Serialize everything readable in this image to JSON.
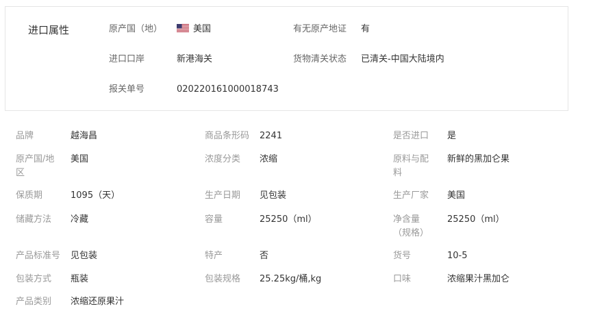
{
  "import_section": {
    "title": "进口属性",
    "origin_country": {
      "label": "原产国（地）",
      "value": "美国",
      "flag": "us-flag"
    },
    "origin_certificate": {
      "label": "有无原产地证",
      "value": "有"
    },
    "port": {
      "label": "进口口岸",
      "value": "新港海关"
    },
    "clearance_status": {
      "label": "货物清关状态",
      "value": "已清关-中国大陆境内"
    },
    "declaration_no": {
      "label": "报关单号",
      "value": "020220161000018743"
    }
  },
  "attributes": {
    "brand": {
      "label": "品牌",
      "value": "越海昌"
    },
    "barcode": {
      "label": "商品条形码",
      "value": "2241"
    },
    "imported": {
      "label": "是否进口",
      "value": "是"
    },
    "origin": {
      "label": "原产国/地区",
      "value": "美国"
    },
    "concentration": {
      "label": "浓度分类",
      "value": "浓缩"
    },
    "ingredients": {
      "label": "原料与配料",
      "value": "新鲜的黑加仑果"
    },
    "shelf_life": {
      "label": "保质期",
      "value": "1095（天）"
    },
    "production_date": {
      "label": "生产日期",
      "value": "见包装"
    },
    "manufacturer": {
      "label": "生产厂家",
      "value": "美国"
    },
    "storage": {
      "label": "储藏方法",
      "value": "冷藏"
    },
    "capacity": {
      "label": "容量",
      "value": "25250（ml）"
    },
    "net_content": {
      "label": "净含量（规格）",
      "value": "25250（ml）"
    },
    "standard_no": {
      "label": "产品标准号",
      "value": "见包装"
    },
    "specialty": {
      "label": "特产",
      "value": "否"
    },
    "item_no": {
      "label": "货号",
      "value": "10-5"
    },
    "packaging": {
      "label": "包装方式",
      "value": "瓶装"
    },
    "package_spec": {
      "label": "包装规格",
      "value": "25.25kg/桶,kg"
    },
    "flavor": {
      "label": "口味",
      "value": "浓缩果汁黑加仑"
    },
    "category": {
      "label": "产品类别",
      "value": "浓缩还原果汁"
    }
  },
  "colors": {
    "label_text": "#999999",
    "value_text": "#333333",
    "border": "#e5e5e5"
  }
}
